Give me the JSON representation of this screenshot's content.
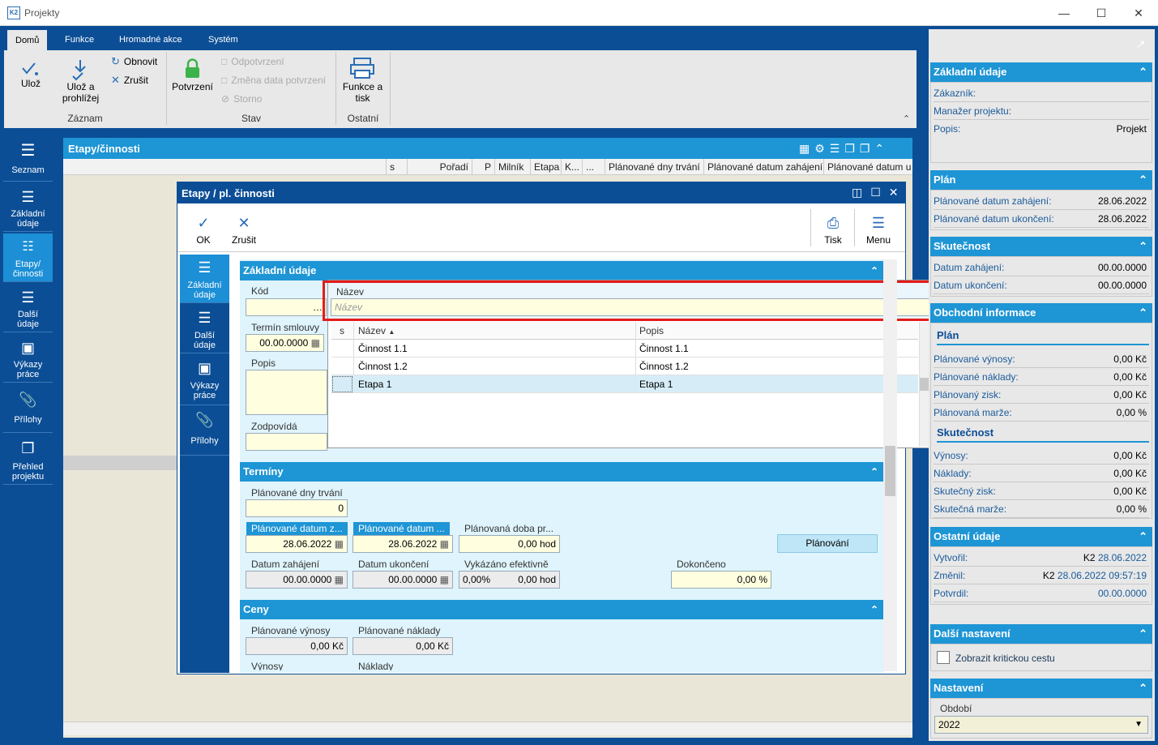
{
  "window": {
    "title": "Projekty"
  },
  "ribbon": {
    "tabs": [
      "Domů",
      "Funkce",
      "Hromadné akce",
      "Systém"
    ],
    "buttons": {
      "uloz": "Ulož",
      "uloz_prohlizej": "Ulož a prohlížej",
      "obnovit": "Obnovit",
      "zrusit": "Zrušit",
      "potvrzeni": "Potvrzení",
      "odpotvrzeni": "Odpotvrzení",
      "zmena_data": "Změna data potvrzení",
      "storno": "Storno",
      "funkce_tisk": "Funkce a tisk"
    },
    "groups": {
      "zaznam": "Záznam",
      "stav": "Stav",
      "ostatni": "Ostatní"
    }
  },
  "nav": {
    "items": [
      "Seznam",
      "Základní údaje",
      "Etapy/ činnosti",
      "Další údaje",
      "Výkazy práce",
      "Přílohy",
      "Přehled projektu"
    ]
  },
  "list": {
    "title": "Etapy/činnosti",
    "columns": [
      "s",
      "Pořadí",
      "P",
      "Milník",
      "Etapa",
      "K...",
      "...",
      "Plánované dny trvání",
      "Plánované datum zahájení",
      "Plánované datum u"
    ]
  },
  "dialog": {
    "title": "Etapy / pl. činnosti",
    "toolbar": {
      "ok": "OK",
      "zrusit": "Zrušit",
      "tisk": "Tisk",
      "menu": "Menu"
    },
    "nav": [
      "Základní údaje",
      "Další údaje",
      "Výkazy práce",
      "Přílohy"
    ],
    "zakladni": {
      "header": "Základní údaje",
      "kod_label": "Kód",
      "kod_value": "",
      "termin_label": "Termín smlouvy",
      "termin_value": "00.00.0000",
      "popis_label": "Popis",
      "zodpovida_label": "Zodpovídá"
    },
    "popup": {
      "nazev_label": "Název",
      "nazev_placeholder": "Název",
      "col_s": "s",
      "col_nazev": "Název",
      "col_popis": "Popis",
      "rows": [
        {
          "nazev": "Činnost 1.1",
          "popis": "Činnost 1.1"
        },
        {
          "nazev": "Činnost 1.2",
          "popis": "Činnost 1.2"
        },
        {
          "nazev": "Etapa 1",
          "popis": "Etapa 1"
        }
      ]
    },
    "terminy": {
      "header": "Termíny",
      "dny_label": "Plánované dny trvání",
      "dny_value": "0",
      "pdz_label": "Plánované datum z...",
      "pdz_value": "28.06.2022",
      "pdu_label": "Plánované datum ...",
      "pdu_value": "28.06.2022",
      "doba_label": "Plánovaná doba pr...",
      "doba_value": "0,00 hod",
      "planovani_button": "Plánování",
      "dz_label": "Datum zahájení",
      "dz_value": "00.00.0000",
      "du_label": "Datum ukončení",
      "du_value": "00.00.0000",
      "vyk_label": "Vykázáno efektivně",
      "vyk_pct": "0,00%",
      "vyk_hod": "0,00 hod",
      "dok_label": "Dokončeno",
      "dok_value": "0,00 %"
    },
    "ceny": {
      "header": "Ceny",
      "pv_label": "Plánované výnosy",
      "pv_value": "0,00 Kč",
      "pn_label": "Plánované náklady",
      "pn_value": "0,00 Kč",
      "v_label": "Výnosy",
      "n_label": "Náklady"
    }
  },
  "right": {
    "zakladni": {
      "header": "Základní údaje",
      "zakaznik": "Zákazník:",
      "manazer": "Manažer projektu:",
      "popis": "Popis:",
      "popis_value": "Projekt"
    },
    "plan": {
      "header": "Plán",
      "pdz": "Plánované datum zahájení:",
      "pdz_value": "28.06.2022",
      "pdu": "Plánované datum ukončení:",
      "pdu_value": "28.06.2022"
    },
    "skut": {
      "header": "Skutečnost",
      "dz": "Datum zahájení:",
      "dz_value": "00.00.0000",
      "du": "Datum ukončení:",
      "du_value": "00.00.0000"
    },
    "obch": {
      "header": "Obchodní informace",
      "plan_sub": "Plán",
      "pv": "Plánované výnosy:",
      "pv_value": "0,00 Kč",
      "pn": "Plánované náklady:",
      "pn_value": "0,00 Kč",
      "pz": "Plánovaný zisk:",
      "pz_value": "0,00 Kč",
      "pm": "Plánovaná marže:",
      "pm_value": "0,00 %",
      "skut_sub": "Skutečnost",
      "v": "Výnosy:",
      "v_value": "0,00 Kč",
      "n": "Náklady:",
      "n_value": "0,00 Kč",
      "sz": "Skutečný zisk:",
      "sz_value": "0,00 Kč",
      "sm": "Skutečná marže:",
      "sm_value": "0,00 %"
    },
    "ostatni": {
      "header": "Ostatní údaje",
      "vytvoril": "Vytvořil:",
      "vytvoril_user": "K2",
      "vytvoril_date": "28.06.2022",
      "zmenil": "Změnil:",
      "zmenil_user": "K2",
      "zmenil_date": "28.06.2022 09:57:19",
      "potvrdil": "Potvrdil:",
      "potvrdil_value": "00.00.0000"
    },
    "dalsi": {
      "header": "Další nastavení",
      "kriticka": "Zobrazit kritickou cestu"
    },
    "nastaveni": {
      "header": "Nastavení",
      "obdobi_label": "Období",
      "obdobi_value": "2022"
    }
  },
  "colors": {
    "frame": "#0b4e96",
    "header": "#1e95d5",
    "highlight": "#e41b1b",
    "input": "#ffffe0"
  }
}
